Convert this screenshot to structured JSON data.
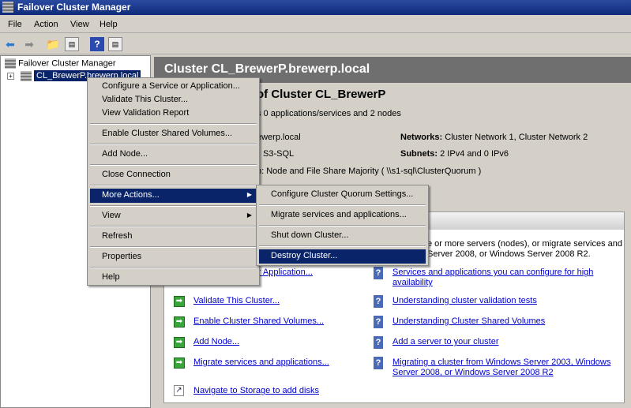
{
  "window": {
    "title": "Failover Cluster Manager"
  },
  "menubar": [
    "File",
    "Action",
    "View",
    "Help"
  ],
  "tree": {
    "root": "Failover Cluster Manager",
    "cluster": "CL_BrewerP.brewerp.local"
  },
  "header": {
    "title": "Cluster CL_BrewerP.brewerp.local"
  },
  "summary": {
    "title": "of Cluster CL_BrewerP",
    "subtitle": "s 0 applications/services and 2 nodes",
    "name_fragment": "ewerp.local",
    "node_fragment": "S3-SQL",
    "quorum_fragment": "n:  Node and File Share Majority ( \\\\s1-sql\\ClusterQuorum )",
    "networks_label": "Networks:",
    "networks_value": "Cluster Network 1, Cluster Network 2",
    "subnets_label": "Subnets:",
    "subnets_value": "2 IPv4 and 0 IPv6"
  },
  "box": {
    "line1": "e or more servers (nodes), or migrate services and",
    "line2": "Server 2008, or Windows Server 2008 R2."
  },
  "actions": [
    "ce or Application...",
    "Validate This Cluster...",
    "Enable Cluster Shared Volumes...",
    "Add Node...",
    "Migrate services and applications...",
    "Navigate to Storage to add disks"
  ],
  "help_links": [
    [
      "Services and applications you can configure for high",
      "availability"
    ],
    [
      "Understanding cluster validation tests"
    ],
    [
      "Understanding Cluster Shared Volumes"
    ],
    [
      "Add a server to your cluster"
    ],
    [
      "Migrating a cluster from Windows Server 2003, Windows",
      "Server 2008, or Windows Server 2008 R2"
    ]
  ],
  "context_menu": [
    "Configure a Service or Application...",
    "Validate This Cluster...",
    "View Validation Report",
    "Enable Cluster Shared Volumes...",
    "Add Node...",
    "Close Connection",
    "More Actions...",
    "View",
    "Refresh",
    "Properties",
    "Help"
  ],
  "submenu": [
    "Configure Cluster Quorum Settings...",
    "Migrate services and applications...",
    "Shut down Cluster...",
    "Destroy Cluster..."
  ]
}
